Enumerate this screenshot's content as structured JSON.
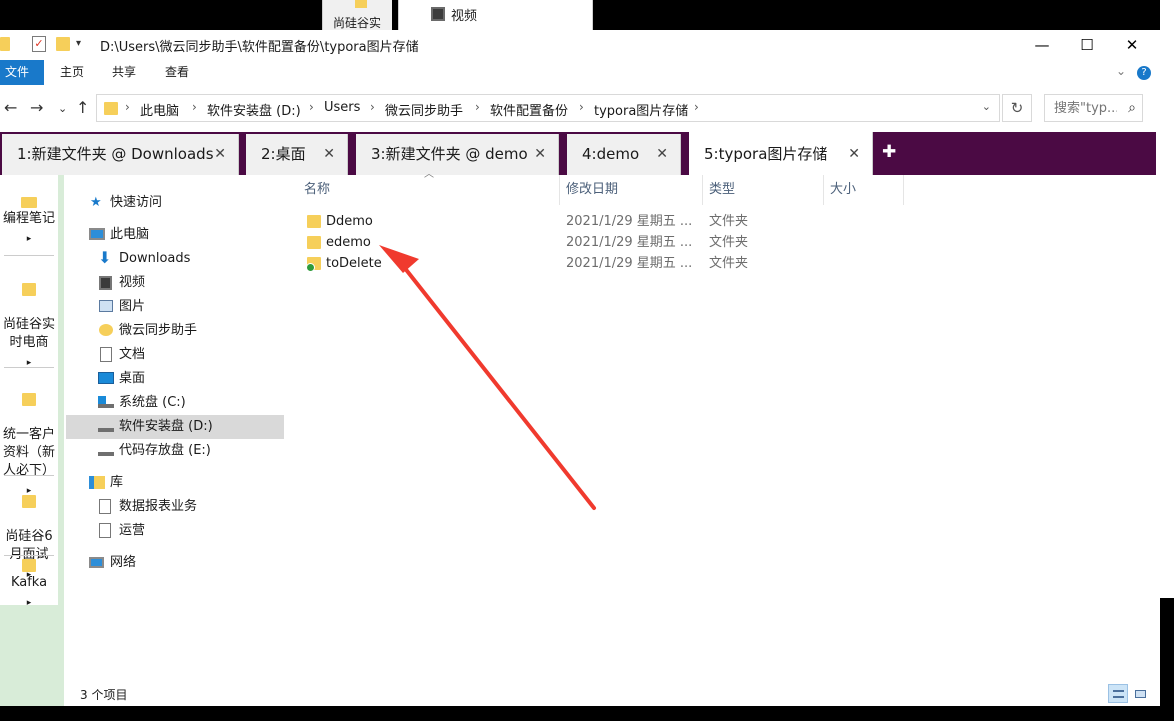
{
  "background": {
    "tab1_label": "尚硅谷实",
    "tab2_label": "视频"
  },
  "titlebar": {
    "path": "D:\\Users\\微云同步助手\\软件配置备份\\typora图片存储",
    "minimize": "—",
    "maximize": "☐",
    "close": "✕"
  },
  "ribbon": {
    "file": "文件",
    "home": "主页",
    "share": "共享",
    "view": "查看",
    "expand": "⌄",
    "help": "?"
  },
  "address": {
    "back": "←",
    "forward": "→",
    "recent": "⌄",
    "up": "↑",
    "crumbs": [
      "此电脑",
      "软件安装盘 (D:)",
      "Users",
      "微云同步助手",
      "软件配置备份",
      "typora图片存储"
    ],
    "dropdown": "⌄",
    "refresh": "↻",
    "search_placeholder": "搜索\"typ...",
    "search_icon": "⌕"
  },
  "tabs": [
    {
      "label": "1:新建文件夹 @ Downloads",
      "close": "✕"
    },
    {
      "label": "2:桌面",
      "close": "✕"
    },
    {
      "label": "3:新建文件夹 @ demo",
      "close": "✕"
    },
    {
      "label": "4:demo",
      "close": "✕"
    },
    {
      "label": "5:typora图片存储",
      "close": "✕"
    }
  ],
  "tab_add": "✚",
  "vbar": {
    "items": [
      "编程笔记",
      "尚硅谷实\n时电商",
      "统一客户\n资料（新\n人必下）",
      "尚硅谷6\n月面试",
      "Kafka"
    ],
    "arrow": "▸"
  },
  "nav": {
    "quick_access": "快速访问",
    "this_pc": "此电脑",
    "downloads": "Downloads",
    "videos": "视频",
    "pictures": "图片",
    "weiyun": "微云同步助手",
    "documents": "文档",
    "desktop": "桌面",
    "drive_c": "系统盘 (C:)",
    "drive_d": "软件安装盘 (D:)",
    "drive_e": "代码存放盘 (E:)",
    "library": "库",
    "lib_reports": "数据报表业务",
    "lib_ops": "运营",
    "network": "网络"
  },
  "columns": {
    "name": "名称",
    "modified": "修改日期",
    "type": "类型",
    "size": "大小",
    "sort_arrow": "︿"
  },
  "files": [
    {
      "name": "Ddemo",
      "modified": "2021/1/29 星期五 ...",
      "type": "文件夹"
    },
    {
      "name": "edemo",
      "modified": "2021/1/29 星期五 ...",
      "type": "文件夹"
    },
    {
      "name": "toDelete",
      "modified": "2021/1/29 星期五 ...",
      "type": "文件夹"
    }
  ],
  "status": {
    "count": "3 个项目"
  },
  "colors": {
    "accent": "#1979ca",
    "tabbar": "#4b0a44",
    "folder": "#f6cf5a",
    "arrow": "#f03a2e"
  }
}
